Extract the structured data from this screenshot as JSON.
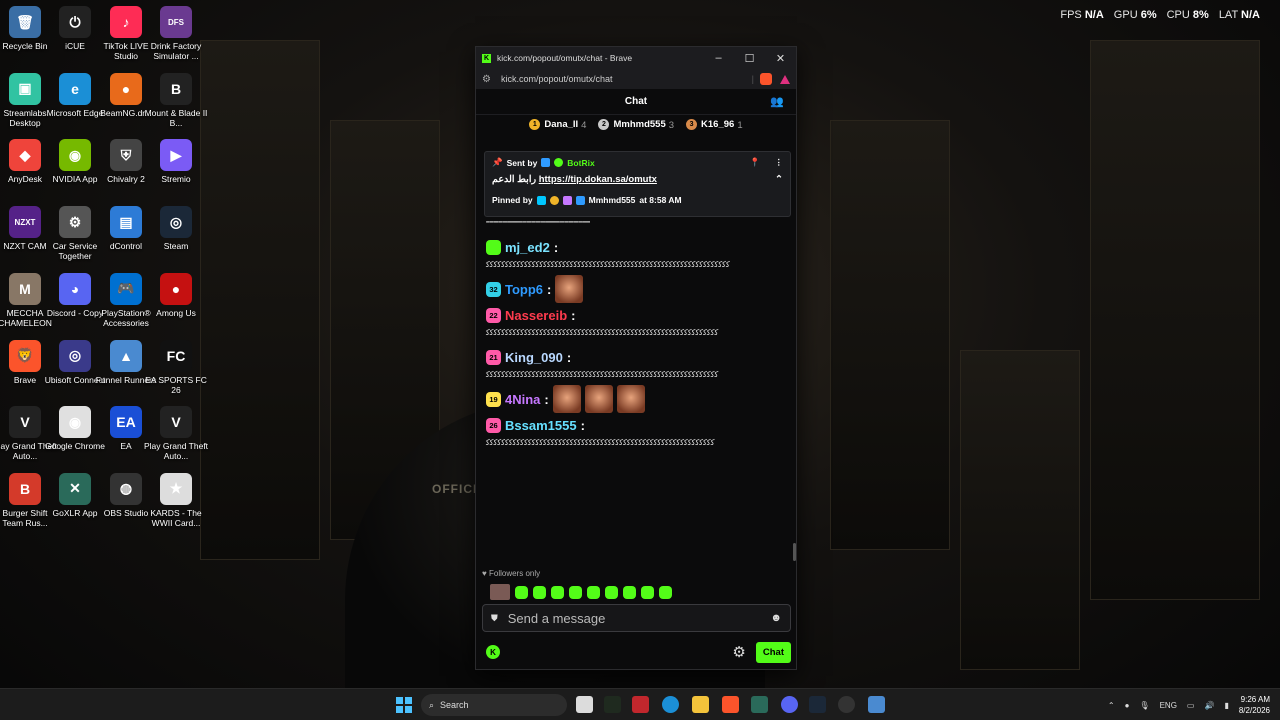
{
  "stats": {
    "fps_label": "FPS",
    "fps_value": "N/A",
    "gpu_label": "GPU",
    "gpu_value": "6%",
    "cpu_label": "CPU",
    "cpu_value": "8%",
    "lat_label": "LAT",
    "lat_value": "N/A"
  },
  "desktop_icons": [
    {
      "label": "Recycle Bin",
      "color": "#3a6ea5",
      "glyph": "🗑"
    },
    {
      "label": "iCUE",
      "color": "#222",
      "glyph": "⏻"
    },
    {
      "label": "TikTok LIVE Studio",
      "color": "#fe2c55",
      "glyph": "♪"
    },
    {
      "label": "Drink Factory Simulator ...",
      "color": "#6a3a90",
      "glyph": "DFS"
    },
    {
      "label": "Streamlabs Desktop",
      "color": "#31c3a2",
      "glyph": "▣"
    },
    {
      "label": "Microsoft Edge",
      "color": "#1b8fd6",
      "glyph": "e"
    },
    {
      "label": "BeamNG.dr...",
      "color": "#e86a1b",
      "glyph": "●"
    },
    {
      "label": "Mount & Blade II B...",
      "color": "#222",
      "glyph": "B"
    },
    {
      "label": "AnyDesk",
      "color": "#ef443b",
      "glyph": "◆"
    },
    {
      "label": "NVIDIA App",
      "color": "#76b900",
      "glyph": "◉"
    },
    {
      "label": "Chivalry 2",
      "color": "#444",
      "glyph": "⛨"
    },
    {
      "label": "Stremio",
      "color": "#7b5bf5",
      "glyph": "▶"
    },
    {
      "label": "NZXT CAM",
      "color": "#552288",
      "glyph": "NZXT"
    },
    {
      "label": "Car Service Together",
      "color": "#555",
      "glyph": "⚙"
    },
    {
      "label": "dControl",
      "color": "#2d7bd6",
      "glyph": "▤"
    },
    {
      "label": "Steam",
      "color": "#1b2838",
      "glyph": "◎"
    },
    {
      "label": "MECCHA CHAMELEON",
      "color": "#887766",
      "glyph": "M"
    },
    {
      "label": "Discord - Copy",
      "color": "#5865f2",
      "glyph": "◕"
    },
    {
      "label": "PlayStation® Accessories",
      "color": "#0070d1",
      "glyph": "🎮"
    },
    {
      "label": "Among Us",
      "color": "#c51111",
      "glyph": "●"
    },
    {
      "label": "Brave",
      "color": "#fb542b",
      "glyph": "🦁"
    },
    {
      "label": "Ubisoft Connect",
      "color": "#3a3a8a",
      "glyph": "◎"
    },
    {
      "label": "Funnel Runners",
      "color": "#4a8ad0",
      "glyph": "▲"
    },
    {
      "label": "EA SPORTS FC 26",
      "color": "#111",
      "glyph": "FC"
    },
    {
      "label": "Play Grand Theft Auto...",
      "color": "#222",
      "glyph": "V"
    },
    {
      "label": "Google Chrome",
      "color": "#e0e0e0",
      "glyph": "◉"
    },
    {
      "label": "EA",
      "color": "#1a4fd6",
      "glyph": "EA"
    },
    {
      "label": "Play Grand Theft Auto...",
      "color": "#222",
      "glyph": "V"
    },
    {
      "label": "Burger Shift Team Rus...",
      "color": "#d43a2a",
      "glyph": "B"
    },
    {
      "label": "GoXLR App",
      "color": "#2a6a5a",
      "glyph": "✕"
    },
    {
      "label": "OBS Studio",
      "color": "#333",
      "glyph": "◍"
    },
    {
      "label": "KARDS - The WWII Card...",
      "color": "#ddd",
      "glyph": "★"
    }
  ],
  "browser": {
    "title": "kick.com/popout/omutx/chat - Brave",
    "url": "kick.com/popout/omutx/chat",
    "accent": "#53fc18"
  },
  "chat": {
    "header": "Chat",
    "leaderboard": [
      {
        "rank": "1",
        "name": "Dana_II",
        "count": "4",
        "color": "#f0b429"
      },
      {
        "rank": "2",
        "name": "Mmhmd555",
        "count": "3",
        "color": "#c9c9c9"
      },
      {
        "rank": "3",
        "name": "K16_96",
        "count": "1",
        "color": "#d88a4a"
      }
    ],
    "pinned": {
      "sent_by_label": "Sent by",
      "sender": "BotRix",
      "message_arabic": "رابط الدعم",
      "message_link": "https://tip.dokan.sa/omutx",
      "pinned_by_label": "Pinned by",
      "pinned_by_user": "Mmhmd555",
      "pinned_at": "at 8:58 AM"
    },
    "spam_top": "'''''''''''''''''''''''''''''''''''''''''''''''''''''''''''''''''''''''''''''''''''''''''''''''''''''",
    "messages": [
      {
        "user": "mj_ed2",
        "badge": "",
        "badge_color": "#53fc18",
        "user_color": "#7be3ff",
        "text": "ﻛﻛﻛﻛﻛﻛﻛﻛﻛﻛﻛﻛﻛﻛﻛﻛﻛﻛﻛﻛﻛﻛﻛﻛﻛﻛﻛﻛﻛﻛﻛﻛﻛﻛﻛﻛﻛﻛﻛﻛﻛﻛﻛﻛﻛﻛﻛﻛﻛﻛﻛﻛﻛﻛﻛﻛﻛﻛﻛﻛﻛﻛﻛﻛ",
        "emotes": 0
      },
      {
        "user": "Topp6",
        "badge": "32",
        "badge_color": "#33d0e8",
        "user_color": "#2f9bff",
        "text": "",
        "emotes": 1
      },
      {
        "user": "Nassereib",
        "badge": "22",
        "badge_color": "#ff5aa8",
        "user_color": "#ff3b4e",
        "text": "ﻛﻛﻛﻛﻛﻛﻛﻛﻛﻛﻛﻛﻛﻛﻛﻛﻛﻛﻛﻛﻛﻛﻛﻛﻛﻛﻛﻛﻛﻛﻛﻛﻛﻛﻛﻛﻛﻛﻛﻛﻛﻛﻛﻛﻛﻛﻛﻛﻛﻛﻛﻛﻛﻛﻛﻛﻛﻛﻛﻛﻛ",
        "emotes": 0
      },
      {
        "user": "King_090",
        "badge": "21",
        "badge_color": "#ff5aa8",
        "user_color": "#b9d8ff",
        "text": "ﻛﻛﻛﻛﻛﻛﻛﻛﻛﻛﻛﻛﻛﻛﻛﻛﻛﻛﻛﻛﻛﻛﻛﻛﻛﻛﻛﻛﻛﻛﻛﻛﻛﻛﻛﻛﻛﻛﻛﻛﻛﻛﻛﻛﻛﻛﻛﻛﻛﻛﻛﻛﻛﻛﻛﻛﻛﻛﻛﻛﻛ",
        "emotes": 0
      },
      {
        "user": "4Nina",
        "badge": "19",
        "badge_color": "#ffe14d",
        "user_color": "#c678ff",
        "text": "",
        "emotes": 3
      },
      {
        "user": "Bssam1555",
        "badge": "26",
        "badge_color": "#ff5aa8",
        "user_color": "#66e0ff",
        "text": "ﻛﻛﻛﻛﻛﻛﻛﻛﻛﻛﻛﻛﻛﻛﻛﻛﻛﻛﻛﻛﻛﻛﻛﻛﻛﻛﻛﻛﻛﻛﻛﻛﻛﻛﻛﻛﻛﻛﻛﻛﻛﻛﻛﻛﻛﻛﻛﻛﻛﻛﻛﻛﻛﻛﻛﻛﻛﻛﻛﻛ",
        "emotes": 0
      }
    ],
    "followers_only": "Followers only",
    "input_placeholder": "Send a message",
    "send_button": "Chat"
  },
  "taskbar": {
    "search": "Search",
    "lang": "ENG",
    "time": "9:26 AM",
    "date": "8/2/2026"
  }
}
